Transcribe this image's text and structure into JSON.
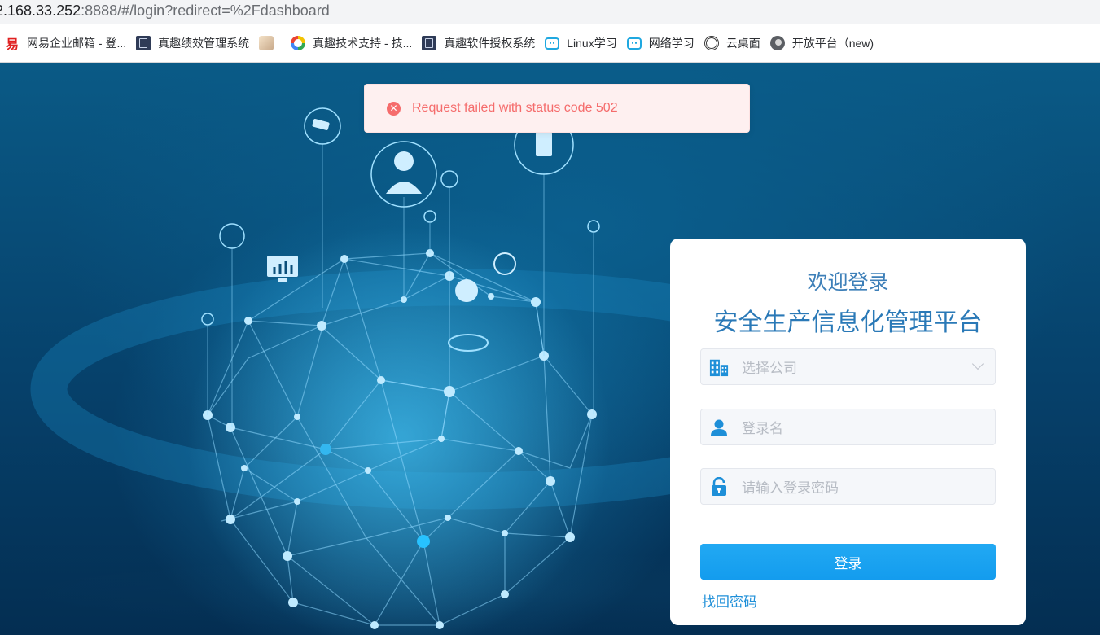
{
  "browser": {
    "url_host": "2.168.33.252",
    "url_rest": ":8888/#/login?redirect=%2Fdashboard",
    "bookmarks": [
      {
        "label": "网易企业邮箱 - 登...",
        "icon": "netease-icon"
      },
      {
        "label": "真趣绩效管理系统",
        "icon": "doc-icon"
      },
      {
        "label": "",
        "icon": "anime-avatar-icon"
      },
      {
        "label": "真趣技术支持 - 技...",
        "icon": "compass-icon"
      },
      {
        "label": "真趣软件授权系统",
        "icon": "doc-icon"
      },
      {
        "label": "Linux学习",
        "icon": "bilibili-tv-icon"
      },
      {
        "label": "网络学习",
        "icon": "bilibili-tv-icon"
      },
      {
        "label": "云桌面",
        "icon": "spiral-icon"
      },
      {
        "label": "开放平台（new)",
        "icon": "globe-icon"
      }
    ]
  },
  "toast": {
    "message": "Request failed with status code 502",
    "icon": "error-circle-icon",
    "color": "#f56c6c"
  },
  "login": {
    "welcome": "欢迎登录",
    "platform_title": "安全生产信息化管理平台",
    "company_placeholder": "选择公司",
    "username_placeholder": "登录名",
    "password_placeholder": "请输入登录密码",
    "submit_label": "登录",
    "forgot_label": "找回密码",
    "accent_color": "#1da1f2"
  }
}
